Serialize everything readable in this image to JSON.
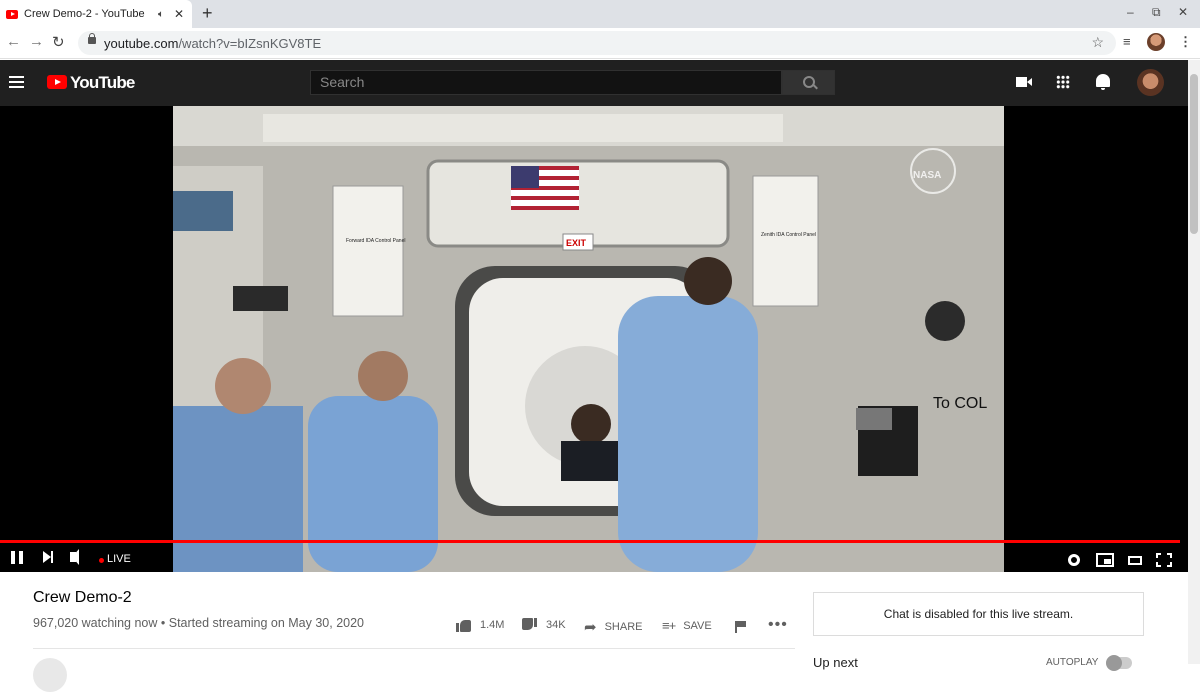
{
  "browser": {
    "tab_title": "Crew Demo-2 - YouTube",
    "url_host": "youtube.com",
    "url_path": "/watch?v=bIZsnKGV8TE"
  },
  "youtube": {
    "logo_text": "YouTube",
    "search_placeholder": "Search"
  },
  "player": {
    "live_label": "LIVE",
    "progress_fraction": 1.0
  },
  "video_overlay": {
    "exit_sign": "EXIT",
    "to_col_sign": "To COL",
    "nasa_logo": "NASA",
    "left_panel_title": "Forward IDA Control Panel",
    "right_panel_title": "Zenith IDA Control Panel"
  },
  "video": {
    "title": "Crew Demo-2",
    "views": "967,020 watching now",
    "started": "Started streaming on May 30, 2020",
    "likes": "1.4M",
    "dislikes": "34K",
    "share_label": "SHARE",
    "save_label": "SAVE"
  },
  "sidebar": {
    "chat_message": "Chat is disabled for this live stream.",
    "up_next": "Up next",
    "autoplay": "AUTOPLAY"
  },
  "colors": {
    "youtube_red": "#ff0000",
    "masthead": "#202020"
  }
}
